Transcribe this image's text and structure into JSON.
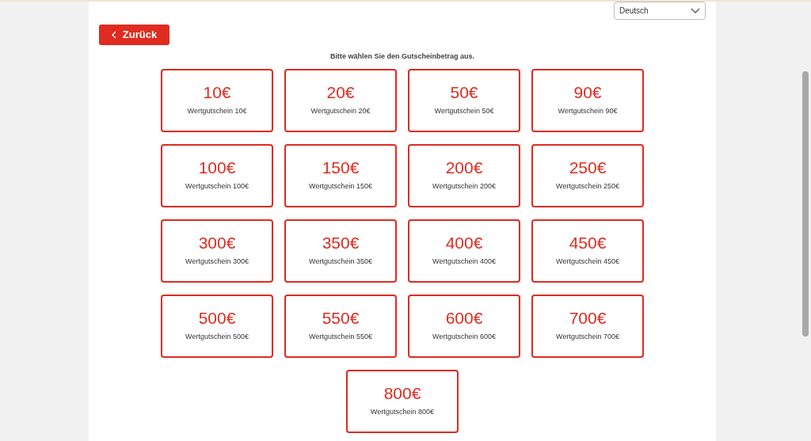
{
  "language_select": {
    "value": "Deutsch"
  },
  "back_button": {
    "label": "Zurück"
  },
  "prompt": "Bitte wählen Sie den Gutscheinbetrag aus.",
  "vouchers": [
    {
      "amount": "10€",
      "label": "Wertgutschein 10€"
    },
    {
      "amount": "20€",
      "label": "Wertgutschein 20€"
    },
    {
      "amount": "50€",
      "label": "Wertgutschein 50€"
    },
    {
      "amount": "90€",
      "label": "Wertgutschein 90€"
    },
    {
      "amount": "100€",
      "label": "Wertgutschein 100€"
    },
    {
      "amount": "150€",
      "label": "Wertgutschein 150€"
    },
    {
      "amount": "200€",
      "label": "Wertgutschein 200€"
    },
    {
      "amount": "250€",
      "label": "Wertgutschein 250€"
    },
    {
      "amount": "300€",
      "label": "Wertgutschein 300€"
    },
    {
      "amount": "350€",
      "label": "Wertgutschein 350€"
    },
    {
      "amount": "400€",
      "label": "Wertgutschein 400€"
    },
    {
      "amount": "450€",
      "label": "Wertgutschein 450€"
    },
    {
      "amount": "500€",
      "label": "Wertgutschein 500€"
    },
    {
      "amount": "550€",
      "label": "Wertgutschein 550€"
    },
    {
      "amount": "600€",
      "label": "Wertgutschein 600€"
    },
    {
      "amount": "700€",
      "label": "Wertgutschein 700€"
    },
    {
      "amount": "800€",
      "label": "Wertgutschein 800€"
    }
  ]
}
